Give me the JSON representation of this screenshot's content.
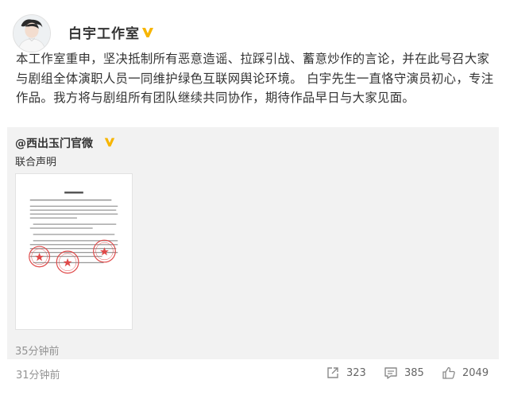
{
  "author": {
    "name": "白宇工作室",
    "verified": true,
    "verified_badge_color": "#f7b500",
    "avatar": "avatar-photo"
  },
  "content": {
    "text": "本工作室重申，坚决抵制所有恶意造谣、拉踩引战、蓄意炒作的言论，并在此号召大家与剧组全体演职人员一同维护绿色互联网舆论环境。 白宇先生一直恪守演员初心，专注作品。我方将与剧组所有团队继续共同协作，期待作品早日与大家见面。"
  },
  "repost": {
    "author": "@西出玉门官微",
    "verified": true,
    "text": "联合声明",
    "image": "joint-statement-document",
    "time": "35分钟前"
  },
  "footer": {
    "time": "31分钟前",
    "repost_count": "323",
    "comment_count": "385",
    "like_count": "2049"
  },
  "colors": {
    "text": "#333333",
    "muted": "#939393",
    "repost_bg": "#f2f2f2",
    "badge": "#f7b500",
    "stamp": "#e04a4a"
  }
}
